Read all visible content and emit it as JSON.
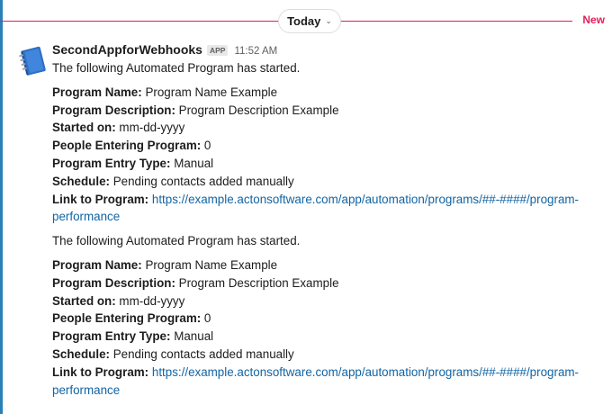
{
  "divider": {
    "day_label": "Today",
    "new_label": "New"
  },
  "message": {
    "sender": "SecondAppforWebhooks",
    "badge": "APP",
    "time": "11:52 AM",
    "posts": [
      {
        "intro": "The following Automated Program has started.",
        "fields": [
          {
            "label": "Program Name:",
            "value": "Program Name Example"
          },
          {
            "label": "Program Description:",
            "value": "Program Description Example"
          },
          {
            "label": "Started on:",
            "value": "mm-dd-yyyy"
          },
          {
            "label": "People Entering Program:",
            "value": "0"
          },
          {
            "label": "Program Entry Type:",
            "value": "Manual"
          },
          {
            "label": "Schedule:",
            "value": "Pending contacts added manually"
          }
        ],
        "link_label": "Link to Program:",
        "link_line1": "https://example.actonsoftware.com/app/automation/programs/##-####/program-",
        "link_line2": "performance"
      },
      {
        "intro": "The following Automated Program has started.",
        "fields": [
          {
            "label": "Program Name:",
            "value": "Program Name Example"
          },
          {
            "label": "Program Description:",
            "value": "Program Description Example"
          },
          {
            "label": "Started on:",
            "value": "mm-dd-yyyy"
          },
          {
            "label": "People Entering Program:",
            "value": "0"
          },
          {
            "label": "Program Entry Type:",
            "value": "Manual"
          },
          {
            "label": "Schedule:",
            "value": "Pending contacts added manually"
          }
        ],
        "link_label": "Link to Program:",
        "link_line1": "https://example.actonsoftware.com/app/automation/programs/##-####/program-",
        "link_line2": "performance"
      }
    ]
  },
  "colors": {
    "accent_bar": "#2a80b9",
    "new_divider": "#e01e5a",
    "link": "#1264a3",
    "avatar_icon": "#2f6fc6"
  },
  "icons": {
    "avatar": "blue-notebook-app-icon",
    "day_dropdown": "chevron-down-icon"
  }
}
